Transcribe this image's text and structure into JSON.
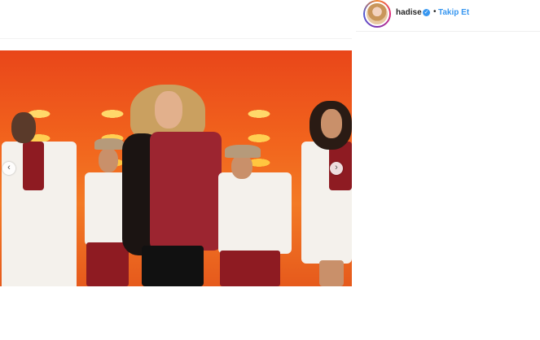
{
  "post": {
    "username": "hadise",
    "separator": "•",
    "follow_label": "Takip Et",
    "verified_glyph": "✓",
    "carousel": {
      "prev_glyph": "‹",
      "next_glyph": "›"
    }
  },
  "icons": {
    "verified": "verified-badge-icon",
    "prev": "chevron-left-icon",
    "next": "chevron-right-icon"
  },
  "colors": {
    "link": "#3897f0",
    "username": "#262626",
    "stage_red": "#e9461a",
    "stage_lights": "#ffd86a",
    "costume_red": "#8e1b22"
  }
}
